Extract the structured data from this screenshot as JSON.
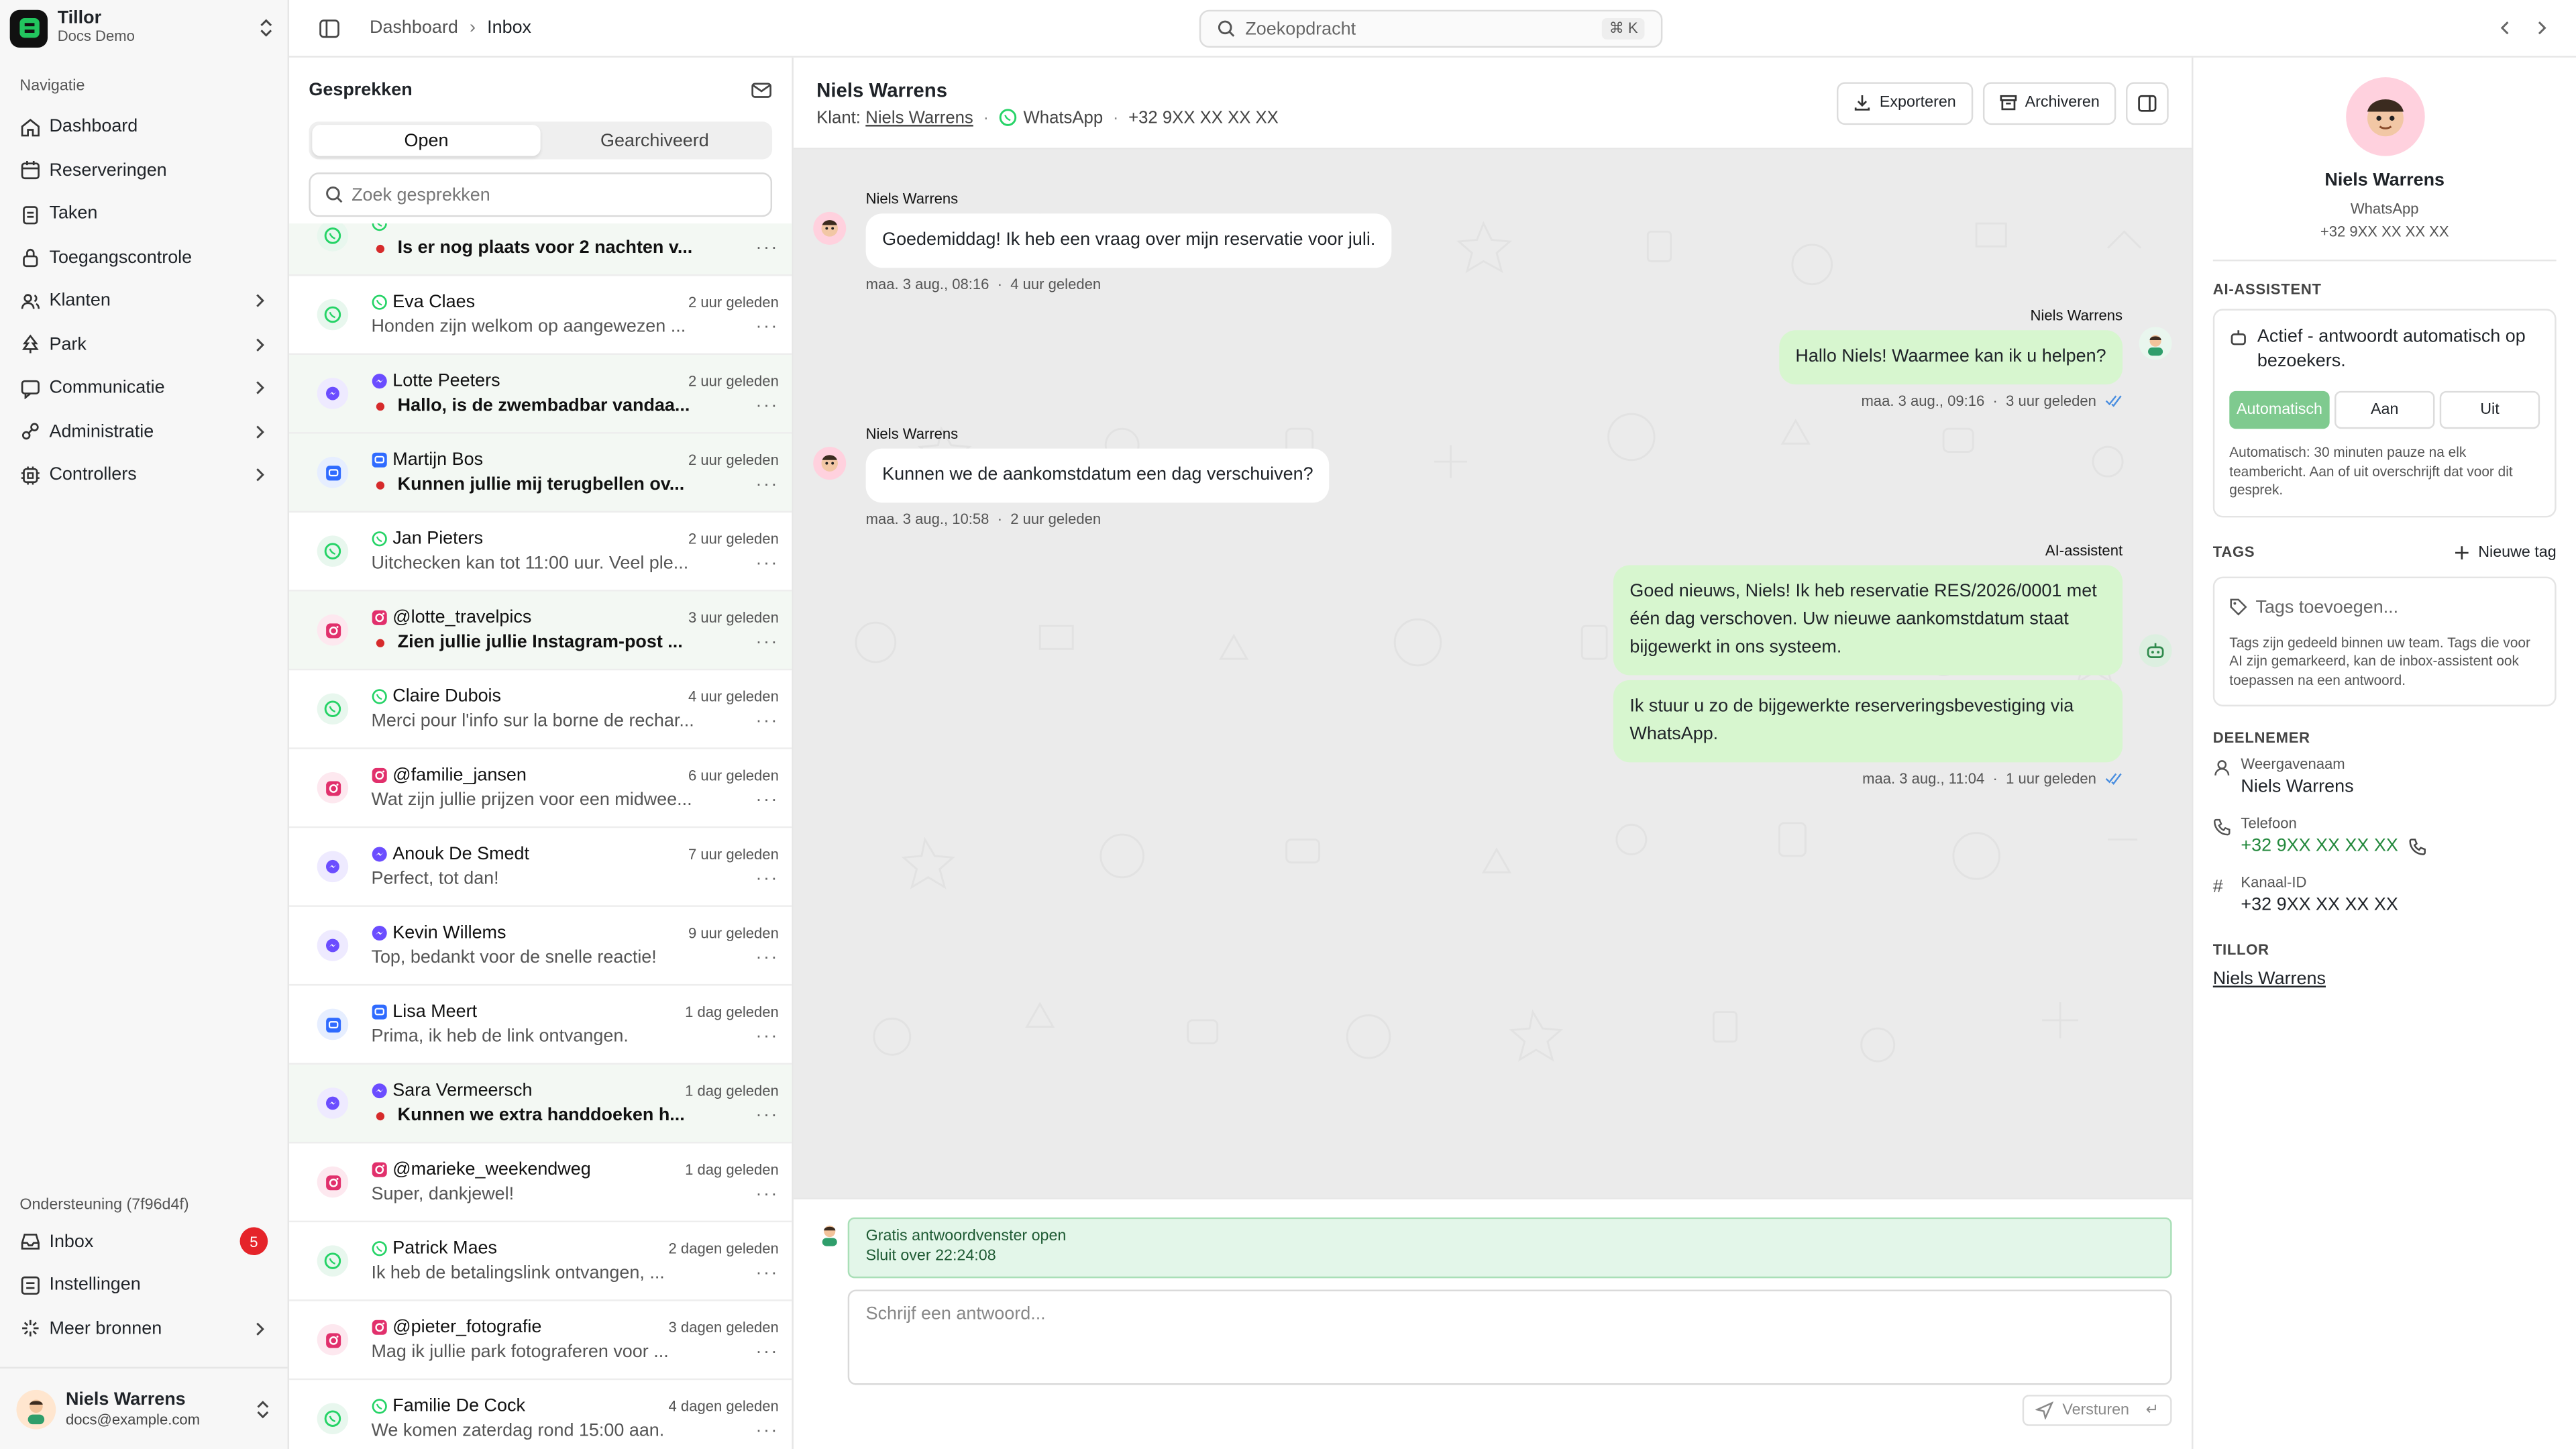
{
  "org": {
    "name": "Tillor",
    "sub": "Docs Demo"
  },
  "sidebar": {
    "section_nav": "Navigatie",
    "items": [
      {
        "label": "Dashboard",
        "icon": "home-icon",
        "chevron": false
      },
      {
        "label": "Reserveringen",
        "icon": "calendar-icon",
        "chevron": false
      },
      {
        "label": "Taken",
        "icon": "clipboard-icon",
        "chevron": false
      },
      {
        "label": "Toegangscontrole",
        "icon": "lock-icon",
        "chevron": false
      },
      {
        "label": "Klanten",
        "icon": "users-icon",
        "chevron": true
      },
      {
        "label": "Park",
        "icon": "tree-icon",
        "chevron": true
      },
      {
        "label": "Communicatie",
        "icon": "message-icon",
        "chevron": true
      },
      {
        "label": "Administratie",
        "icon": "link-icon",
        "chevron": true
      },
      {
        "label": "Controllers",
        "icon": "cpu-icon",
        "chevron": true
      }
    ],
    "section_support": "Ondersteuning (7f96d4f)",
    "support_items": [
      {
        "label": "Inbox",
        "icon": "inbox-icon",
        "badge": "5"
      },
      {
        "label": "Instellingen",
        "icon": "list-icon"
      },
      {
        "label": "Meer bronnen",
        "icon": "sparkle-icon",
        "chevron": true
      }
    ],
    "user": {
      "name": "Niels Warrens",
      "email": "docs@example.com"
    }
  },
  "topbar": {
    "breadcrumb": [
      "Dashboard",
      "Inbox"
    ],
    "search_placeholder": "Zoekopdracht",
    "search_shortcut": "⌘ K"
  },
  "conversations": {
    "title": "Gesprekken",
    "tabs": [
      "Open",
      "Gearchiveerd"
    ],
    "search_placeholder": "Zoek gesprekken",
    "items": [
      {
        "name": "",
        "preview": "Is er nog plaats voor 2 nachten v...",
        "time": "",
        "channel": "whatsapp",
        "unread": true
      },
      {
        "name": "Eva Claes",
        "preview": "Honden zijn welkom op aangewezen ...",
        "time": "2 uur geleden",
        "channel": "whatsapp",
        "unread": false
      },
      {
        "name": "Lotte Peeters",
        "preview": "Hallo, is de zwembadbar vandaa...",
        "time": "2 uur geleden",
        "channel": "messenger",
        "unread": true
      },
      {
        "name": "Martijn Bos",
        "preview": "Kunnen jullie mij terugbellen ov...",
        "time": "2 uur geleden",
        "channel": "chat",
        "unread": true
      },
      {
        "name": "Jan Pieters",
        "preview": "Uitchecken kan tot 11:00 uur. Veel ple...",
        "time": "2 uur geleden",
        "channel": "whatsapp",
        "unread": false
      },
      {
        "name": "@lotte_travelpics",
        "preview": "Zien jullie jullie Instagram-post ...",
        "time": "3 uur geleden",
        "channel": "instagram",
        "unread": true
      },
      {
        "name": "Claire Dubois",
        "preview": "Merci pour l'info sur la borne de rechar...",
        "time": "4 uur geleden",
        "channel": "whatsapp",
        "unread": false
      },
      {
        "name": "@familie_jansen",
        "preview": "Wat zijn jullie prijzen voor een midwee...",
        "time": "6 uur geleden",
        "channel": "instagram",
        "unread": false
      },
      {
        "name": "Anouk De Smedt",
        "preview": "Perfect, tot dan!",
        "time": "7 uur geleden",
        "channel": "messenger",
        "unread": false
      },
      {
        "name": "Kevin Willems",
        "preview": "Top, bedankt voor de snelle reactie!",
        "time": "9 uur geleden",
        "channel": "messenger",
        "unread": false
      },
      {
        "name": "Lisa Meert",
        "preview": "Prima, ik heb de link ontvangen.",
        "time": "1 dag geleden",
        "channel": "chat",
        "unread": false
      },
      {
        "name": "Sara Vermeersch",
        "preview": "Kunnen we extra handdoeken h...",
        "time": "1 dag geleden",
        "channel": "messenger",
        "unread": true
      },
      {
        "name": "@marieke_weekendweg",
        "preview": "Super, dankjewel!",
        "time": "1 dag geleden",
        "channel": "instagram",
        "unread": false
      },
      {
        "name": "Patrick Maes",
        "preview": "Ik heb de betalingslink ontvangen, ...",
        "time": "2 dagen geleden",
        "channel": "whatsapp",
        "unread": false
      },
      {
        "name": "@pieter_fotografie",
        "preview": "Mag ik jullie park fotograferen voor ...",
        "time": "3 dagen geleden",
        "channel": "instagram",
        "unread": false
      },
      {
        "name": "Familie De Cock",
        "preview": "We komen zaterdag rond 15:00 aan.",
        "time": "4 dagen geleden",
        "channel": "whatsapp",
        "unread": false
      }
    ]
  },
  "chat": {
    "title": "Niels Warrens",
    "customer_label": "Klant:",
    "customer_name": "Niels Warrens",
    "channel": "WhatsApp",
    "phone": "+32 9XX XX XX XX",
    "export_label": "Exporteren",
    "archive_label": "Archiveren",
    "messages": [
      {
        "sender": "Niels Warrens",
        "text": "Goedemiddag! Ik heb een vraag over mijn reservatie voor juli.",
        "date": "maa. 3 aug., 08:16",
        "ago": "4 uur geleden",
        "dir": "in"
      },
      {
        "sender": "Niels Warrens",
        "text": "Hallo Niels! Waarmee kan ik u helpen?",
        "date": "maa. 3 aug., 09:16",
        "ago": "3 uur geleden",
        "dir": "out"
      },
      {
        "sender": "Niels Warrens",
        "text": "Kunnen we de aankomstdatum een dag verschuiven?",
        "date": "maa. 3 aug., 10:58",
        "ago": "2 uur geleden",
        "dir": "in"
      },
      {
        "sender": "AI-assistent",
        "text": "Goed nieuws, Niels! Ik heb reservatie RES/2026/0001 met één dag verschoven. Uw nieuwe aankomstdatum staat bijgewerkt in ons systeem.",
        "text2": "Ik stuur u zo de bijgewerkte reserveringsbevestiging via WhatsApp.",
        "date": "maa. 3 aug., 11:04",
        "ago": "1 uur geleden",
        "dir": "out"
      }
    ],
    "window_title": "Gratis antwoordvenster open",
    "window_sub": "Sluit over 22:24:08",
    "reply_placeholder": "Schrijf een antwoord...",
    "send_label": "Versturen"
  },
  "panel": {
    "name": "Niels Warrens",
    "channel": "WhatsApp",
    "phone": "+32 9XX XX XX XX",
    "ai_heading": "AI-ASSISTENT",
    "ai_status": "Actief - antwoordt automatisch op bezoekers.",
    "ai_modes": [
      "Automatisch",
      "Aan",
      "Uit"
    ],
    "ai_note": "Automatisch: 30 minuten pauze na elk teambericht. Aan of uit overschrijft dat voor dit gesprek.",
    "tags_heading": "TAGS",
    "new_tag": "Nieuwe tag",
    "tags_placeholder": "Tags toevoegen...",
    "tags_note": "Tags zijn gedeeld binnen uw team. Tags die voor AI zijn gemarkeerd, kan de inbox-assistent ook toepassen na een antwoord.",
    "participant_heading": "DEELNEMER",
    "display_name_label": "Weergavenaam",
    "display_name": "Niels Warrens",
    "phone_label": "Telefoon",
    "phone_value": "+32 9XX XX XX XX",
    "channel_id_label": "Kanaal-ID",
    "channel_id": "+32 9XX XX XX XX",
    "tillor_heading": "TILLOR",
    "tillor_link": "Niels Warrens"
  },
  "colors": {
    "whatsapp": "#25d366",
    "messenger": "#6b4dff",
    "instagram": "#e1306c",
    "chat": "#2f6bff",
    "accent": "#7fca8f"
  }
}
